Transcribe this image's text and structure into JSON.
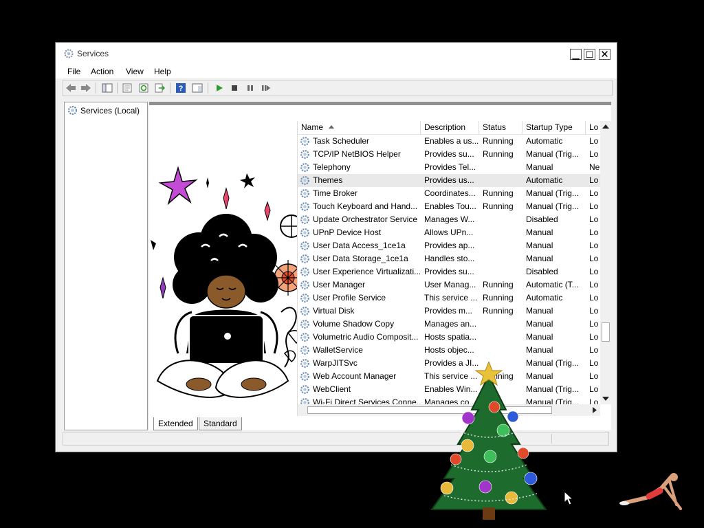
{
  "window": {
    "title": "Services",
    "controls": {
      "minimize": "▁",
      "maximize": "☐",
      "close": "✕"
    }
  },
  "menu": {
    "items": [
      "File",
      "Action",
      "View",
      "Help"
    ]
  },
  "tree": {
    "root_label": "Services (Local)"
  },
  "list": {
    "columns": [
      "Name",
      "Description",
      "Status",
      "Startup Type",
      "Lo"
    ],
    "rows": [
      {
        "name": "Task Scheduler",
        "description": "Enables a us...",
        "status": "Running",
        "startup": "Automatic",
        "logon": "Lo"
      },
      {
        "name": "TCP/IP NetBIOS Helper",
        "description": "Provides su...",
        "status": "Running",
        "startup": "Manual (Trig...",
        "logon": "Lo"
      },
      {
        "name": "Telephony",
        "description": "Provides Tel...",
        "status": "",
        "startup": "Manual",
        "logon": "Ne"
      },
      {
        "name": "Themes",
        "description": "Provides us...",
        "status": "",
        "startup": "Automatic",
        "logon": "Lo"
      },
      {
        "name": "Time Broker",
        "description": "Coordinates...",
        "status": "Running",
        "startup": "Manual (Trig...",
        "logon": "Lo"
      },
      {
        "name": "Touch Keyboard and Hand...",
        "description": "Enables Tou...",
        "status": "Running",
        "startup": "Manual (Trig...",
        "logon": "Lo"
      },
      {
        "name": "Update Orchestrator Service",
        "description": "Manages W...",
        "status": "",
        "startup": "Disabled",
        "logon": "Lo"
      },
      {
        "name": "UPnP Device Host",
        "description": "Allows UPn...",
        "status": "",
        "startup": "Manual",
        "logon": "Lo"
      },
      {
        "name": "User Data Access_1ce1a",
        "description": "Provides ap...",
        "status": "",
        "startup": "Manual",
        "logon": "Lo"
      },
      {
        "name": "User Data Storage_1ce1a",
        "description": "Handles sto...",
        "status": "",
        "startup": "Manual",
        "logon": "Lo"
      },
      {
        "name": "User Experience Virtualizati...",
        "description": "Provides su...",
        "status": "",
        "startup": "Disabled",
        "logon": "Lo"
      },
      {
        "name": "User Manager",
        "description": "User Manag...",
        "status": "Running",
        "startup": "Automatic (T...",
        "logon": "Lo"
      },
      {
        "name": "User Profile Service",
        "description": "This service ...",
        "status": "Running",
        "startup": "Automatic",
        "logon": "Lo"
      },
      {
        "name": "Virtual Disk",
        "description": "Provides m...",
        "status": "Running",
        "startup": "Manual",
        "logon": "Lo"
      },
      {
        "name": "Volume Shadow Copy",
        "description": "Manages an...",
        "status": "",
        "startup": "Manual",
        "logon": "Lo"
      },
      {
        "name": "Volumetric Audio Composit...",
        "description": "Hosts spatia...",
        "status": "",
        "startup": "Manual",
        "logon": "Lo"
      },
      {
        "name": "WalletService",
        "description": "Hosts objec...",
        "status": "",
        "startup": "Manual",
        "logon": "Lo"
      },
      {
        "name": "WarpJITSvc",
        "description": "Provides a JI...",
        "status": "",
        "startup": "Manual (Trig...",
        "logon": "Lo"
      },
      {
        "name": "Web Account Manager",
        "description": "This service ...",
        "status": "Running",
        "startup": "Manual",
        "logon": "Lo"
      },
      {
        "name": "WebClient",
        "description": "Enables Win...",
        "status": "",
        "startup": "Manual (Trig...",
        "logon": "Lo"
      },
      {
        "name": "Wi-Fi Direct Services Conne...",
        "description": "Manages co...",
        "status": "",
        "startup": "Manual (Trig...",
        "logon": "Lo"
      }
    ],
    "selected_row": "Themes"
  },
  "tabs": [
    "Extended",
    "Standard"
  ],
  "colors": {
    "play": "#2a9d2a",
    "help_blue": "#2b5db8",
    "gear": "#6d8fb3"
  }
}
